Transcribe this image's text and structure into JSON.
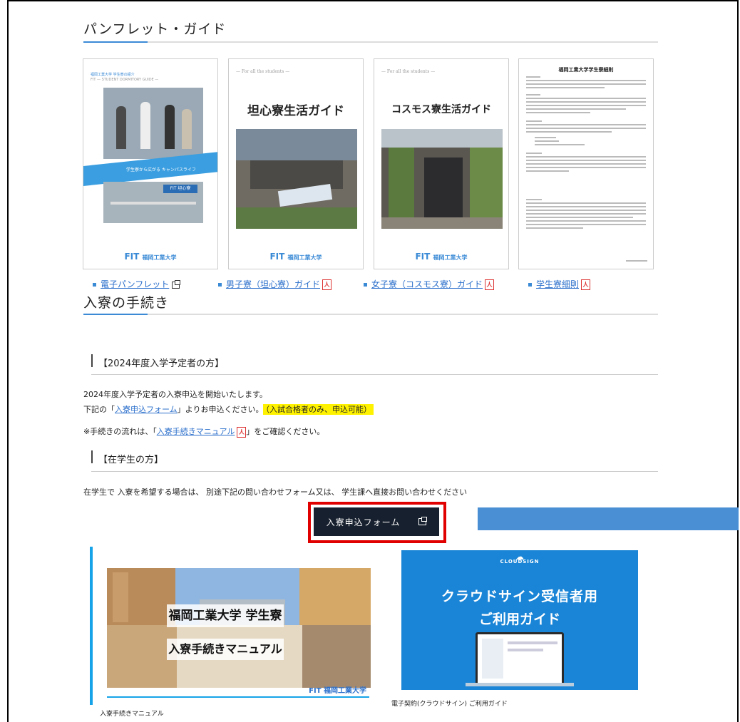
{
  "pamphlet": {
    "title": "パンフレット・ガイド",
    "cards": [
      {
        "top_text": "福岡工業大学 学生寮の紹介",
        "sub_text": "FIT — STUDENT DORMITORY GUIDE —",
        "banner": "学生寮から広がる キャンパスライフ",
        "sign": "FIT 坦心寮",
        "brand": "FIT",
        "brand_sub": "福岡工業大学"
      },
      {
        "top_text": "— For all the students —",
        "title": "坦心寮生活ガイド",
        "brand": "FIT",
        "brand_sub": "福岡工業大学"
      },
      {
        "top_text": "— For all the students —",
        "title": "コスモス寮生活ガイド",
        "brand": "FIT",
        "brand_sub": "福岡工業大学"
      },
      {
        "title": "福岡工業大学学生寮細則"
      }
    ],
    "links": [
      {
        "label": "電子パンフレット",
        "icon": "external-link-icon"
      },
      {
        "label": "男子寮（坦心寮）ガイド",
        "icon": "pdf-icon"
      },
      {
        "label": "女子寮（コスモス寮）ガイド",
        "icon": "pdf-icon"
      },
      {
        "label": "学生寮細則",
        "icon": "pdf-icon"
      }
    ]
  },
  "procedure": {
    "title": "入寮の手続き",
    "new_students": {
      "heading": "【2024年度入学予定者の方】",
      "line1": "2024年度入学予定者の入寮申込を開始いたします。",
      "line2_pre": "下記の「",
      "line2_link": "入寮申込フォーム",
      "line2_post": "」よりお申込ください。",
      "highlight": "（入試合格者のみ、申込可能）",
      "line3_pre": "※手続きの流れは、「",
      "line3_link": "入寮手続きマニュアル",
      "line3_post": "」をご確認ください。"
    },
    "current_students": {
      "heading": "【在学生の方】",
      "line": "在学生で 入寮を希望する場合は、 別途下記の問い合わせフォーム又は、 学生課へ直接お問い合わせください"
    },
    "button_label": "入寮申込フォーム"
  },
  "manual_banner": {
    "line1": "福岡工業大学 学生寮",
    "line2": "入寮手続きマニュアル",
    "brand": "FIT 福岡工業大学",
    "caption": "入寮手続きマニュアル"
  },
  "cloudsign_banner": {
    "logo": "CLOUDSIGN",
    "line1": "クラウドサイン受信者用",
    "line2": "ご利用ガイド",
    "caption": "電子契約(クラウドサイン) ご利用ガイド"
  },
  "colors": {
    "accent": "#3a8ad6",
    "button": "#17202e",
    "highlight": "#fff200",
    "outline": "#e10000",
    "cloudsign": "#1a85d6"
  }
}
